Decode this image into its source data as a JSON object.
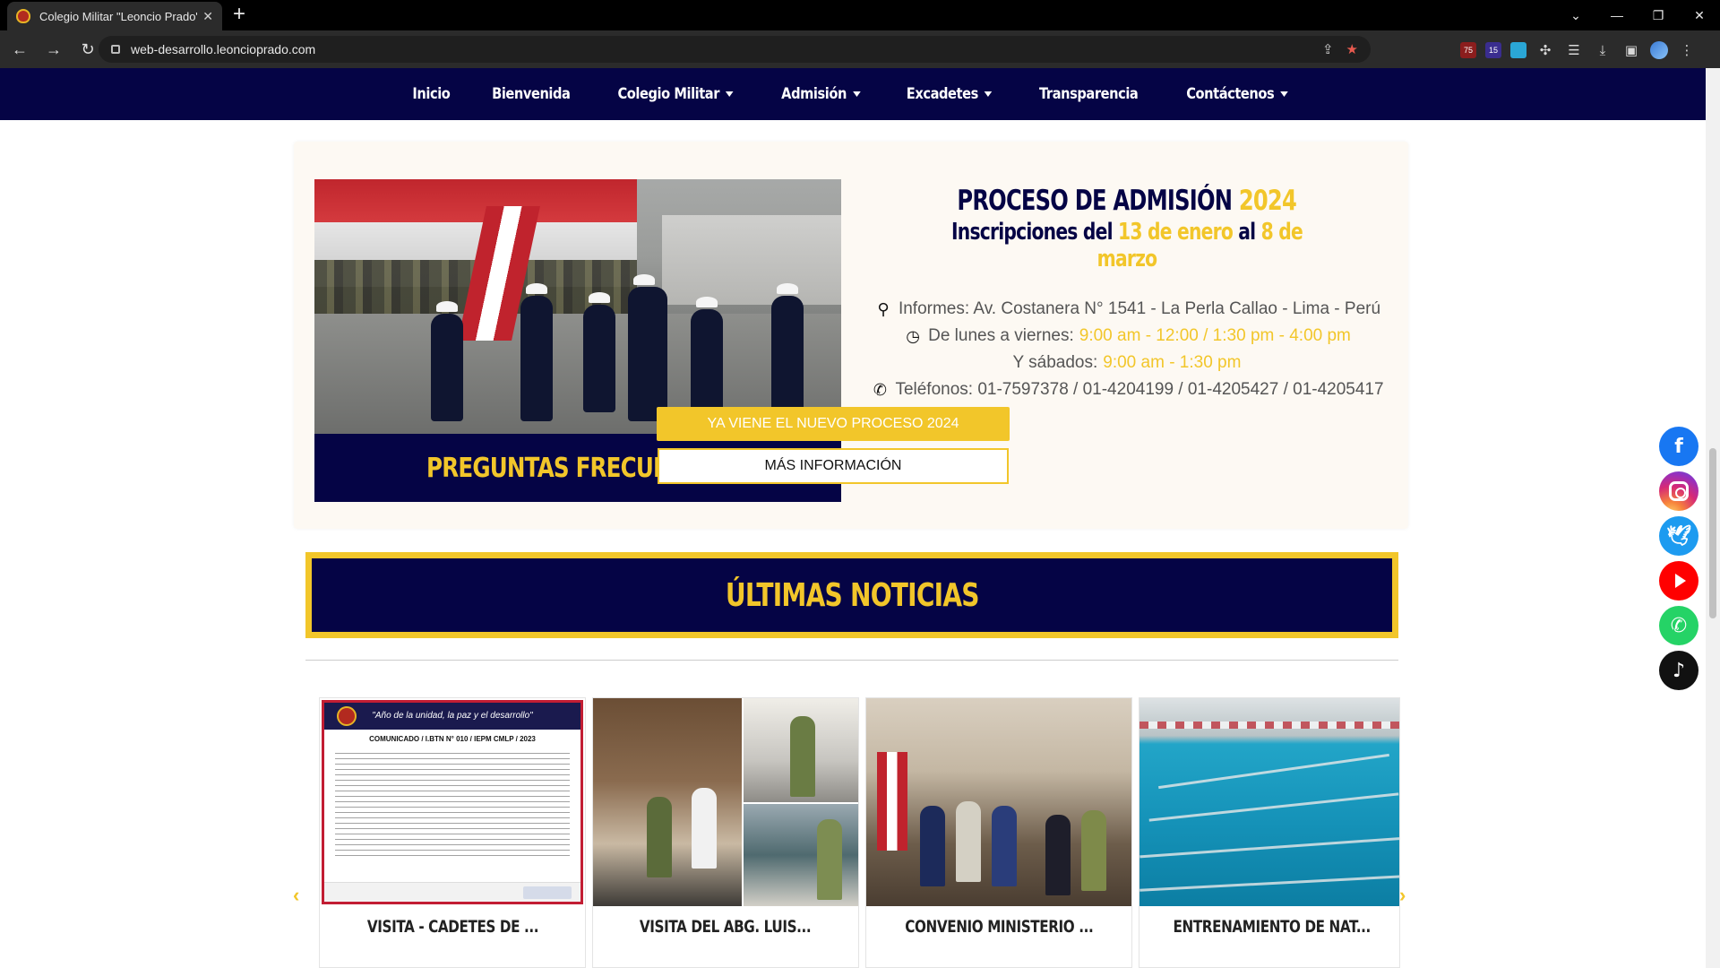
{
  "browser": {
    "tab_title": "Colegio Militar \"Leoncio Prado\"",
    "url": "web-desarrollo.leoncioprado.com",
    "ext_badge_1": "75",
    "ext_badge_2": "15"
  },
  "nav": {
    "items": [
      {
        "label": "Inicio",
        "dropdown": false
      },
      {
        "label": "Bienvenida",
        "dropdown": false
      },
      {
        "label": "Colegio Militar",
        "dropdown": true
      },
      {
        "label": "Admisión",
        "dropdown": true
      },
      {
        "label": "Excadetes",
        "dropdown": true
      },
      {
        "label": "Transparencia",
        "dropdown": false
      },
      {
        "label": "Contáctenos",
        "dropdown": true
      }
    ]
  },
  "admission": {
    "photo_caption": "PREGUNTAS FRECUENTES",
    "title_main": "PROCESO DE ADMISIÓN",
    "title_year": "2024",
    "sub_prefix": "Inscripciones del",
    "sub_start": "13 de enero",
    "sub_mid": "al",
    "sub_end": "8 de marzo",
    "info_address": "Informes: Av. Costanera N° 1541 - La Perla Callao - Lima - Perú",
    "info_weekday_label": "De lunes a viernes:",
    "info_weekday_hours": "9:00 am - 12:00 / 1:30 pm - 4:00 pm",
    "info_saturday_label": "Y sábados:",
    "info_saturday_hours": "9:00 am - 1:30 pm",
    "info_phones": "Teléfonos: 01-7597378 / 01-4204199 / 01-4205427 / 01-4205417",
    "btn_primary": "YA VIENE EL NUEVO PROCESO 2024",
    "btn_secondary": "MÁS INFORMACIÓN"
  },
  "news": {
    "heading": "ÚLTIMAS NOTICIAS",
    "cards": [
      {
        "title": "VISITA - CADETES DE ..."
      },
      {
        "title": "VISITA DEL ABG. LUIS..."
      },
      {
        "title": "CONVENIO MINISTERIO ..."
      },
      {
        "title": "ENTRENAMIENTO DE NAT..."
      }
    ],
    "doc_heading": "\"Año de la unidad, la paz y el desarrollo\"",
    "doc_subheading": "COMUNICADO / I.BTN N° 010 / IEPM CMLP / 2023"
  },
  "social": [
    "facebook-icon",
    "instagram-icon",
    "twitter-icon",
    "youtube-icon",
    "whatsapp-icon",
    "tiktok-icon"
  ],
  "colors": {
    "navy": "#050445",
    "gold": "#f2c62a",
    "cream": "#fdf9f3"
  }
}
